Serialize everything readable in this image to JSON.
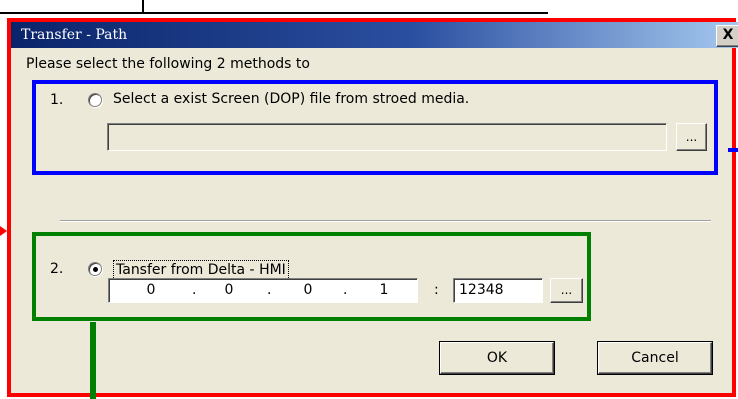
{
  "window": {
    "title": "Transfer - Path",
    "close_glyph": "X"
  },
  "instruction": "Please select the following 2 methods to",
  "option1": {
    "number": "1.",
    "label": "Select a exist  Screen (DOP) file from stroed media.",
    "path_value": "",
    "browse_label": "..."
  },
  "option2": {
    "number": "2.",
    "label": "Tansfer from Delta - HMI",
    "ip": [
      "0",
      "0",
      "0",
      "1"
    ],
    "ip_sep": ".",
    "port_sep": ":",
    "port": "12348",
    "browse_label": "..."
  },
  "buttons": {
    "ok": "OK",
    "cancel": "Cancel"
  },
  "annotation_colors": {
    "outer": "#ff0000",
    "option1": "#0000ff",
    "option2": "#008000"
  }
}
